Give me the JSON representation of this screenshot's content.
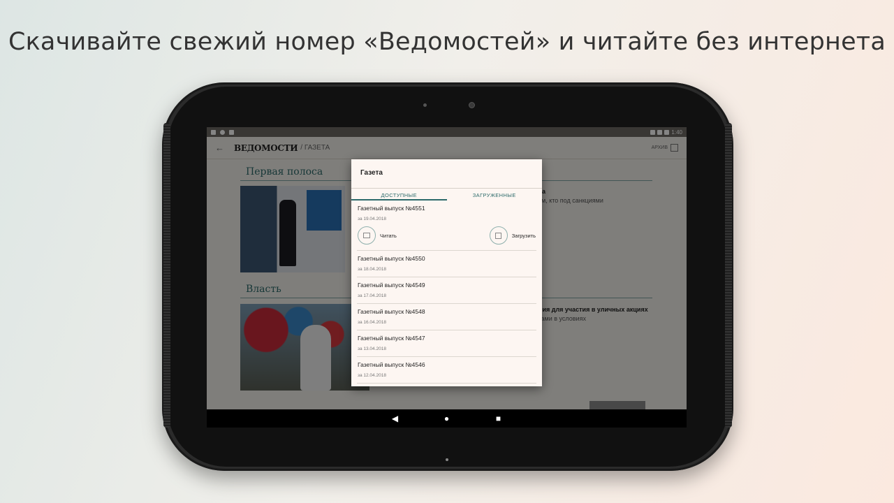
{
  "headline": "Скачивайте свежий номер «Ведомостей» и читайте без интернета",
  "status_bar": {
    "time": "1:40"
  },
  "app_toolbar": {
    "back_icon": "arrow-left-icon",
    "logo": "ВЕДОМОСТИ",
    "breadcrumb": "/ ГАЗЕТА",
    "archive_label": "АРХИВ"
  },
  "background_sections": {
    "section1": "Первая полоса",
    "section2": "Власть",
    "snippet1_title": "еса",
    "snippet1_sub": "тем, кто под санкциями",
    "snippet2_title": "ания для участия в уличных акциях",
    "snippet2_sub": "стами в условиях"
  },
  "dialog": {
    "title": "Газета",
    "tabs": [
      {
        "label": "ДОСТУПНЫЕ"
      },
      {
        "label": "ЗАГРУЖЕННЫЕ"
      }
    ],
    "issues": [
      {
        "title": "Газетный выпуск №4551",
        "date": "за 19.04.2018"
      },
      {
        "title": "Газетный выпуск №4550",
        "date": "за 18.04.2018"
      },
      {
        "title": "Газетный выпуск №4549",
        "date": "за 17.04.2018"
      },
      {
        "title": "Газетный выпуск №4548",
        "date": "за 16.04.2018"
      },
      {
        "title": "Газетный выпуск №4547",
        "date": "за 13.04.2018"
      },
      {
        "title": "Газетный выпуск №4546",
        "date": "за 12.04.2018"
      }
    ],
    "read_label": "Читать",
    "download_label": "Загрузить"
  },
  "nav_bar": {
    "back": "◀",
    "home": "●",
    "recents": "■"
  }
}
